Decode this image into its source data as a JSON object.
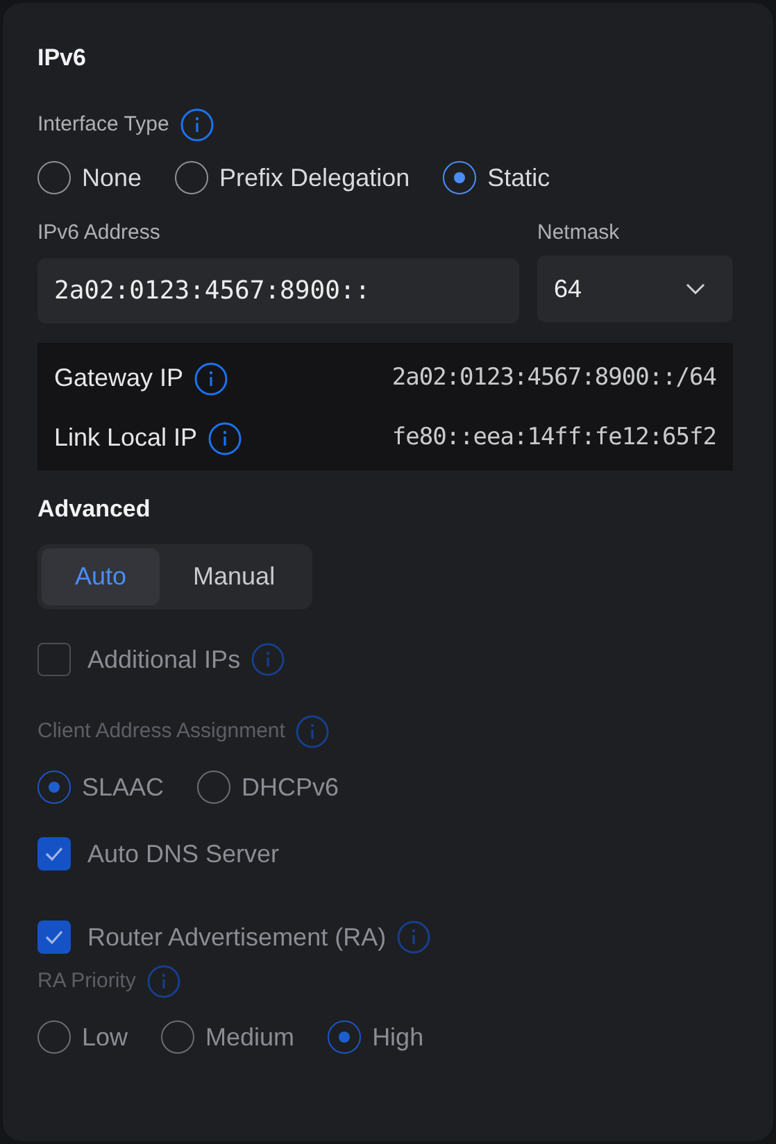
{
  "section_title": "IPv6",
  "interface_type": {
    "label": "Interface Type",
    "info": true,
    "options": [
      {
        "label": "None",
        "selected": false
      },
      {
        "label": "Prefix Delegation",
        "selected": false
      },
      {
        "label": "Static",
        "selected": true
      }
    ]
  },
  "ipv6_address": {
    "label": "IPv6 Address",
    "value": "2a02:0123:4567:8900::"
  },
  "netmask": {
    "label": "Netmask",
    "value": "64"
  },
  "info_rows": [
    {
      "label": "Gateway IP",
      "info": true,
      "value": "2a02:0123:4567:8900::/64"
    },
    {
      "label": "Link Local IP",
      "info": true,
      "value": "fe80::eea:14ff:fe12:65f2"
    }
  ],
  "advanced": {
    "title": "Advanced",
    "modes": [
      {
        "label": "Auto",
        "selected": true
      },
      {
        "label": "Manual",
        "selected": false
      }
    ],
    "items": [
      {
        "kind": "checkbox",
        "label": "Additional IPs",
        "checked": false,
        "disabled": true,
        "info": true
      },
      {
        "kind": "radio_group",
        "label": "Client Address Assignment",
        "disabled": true,
        "info": true,
        "options": [
          {
            "label": "SLAAC",
            "selected": true
          },
          {
            "label": "DHCPv6",
            "selected": false
          }
        ]
      },
      {
        "kind": "checkbox",
        "label": "Auto DNS Server",
        "checked": true,
        "disabled": true,
        "info": false
      },
      {
        "kind": "checkbox",
        "label": "Router Advertisement (RA)",
        "checked": true,
        "disabled": true,
        "info": true
      },
      {
        "kind": "radio_group",
        "label": "RA Priority",
        "disabled": true,
        "info": true,
        "options": [
          {
            "label": "Low",
            "selected": false
          },
          {
            "label": "Medium",
            "selected": false
          },
          {
            "label": "High",
            "selected": true
          }
        ]
      }
    ]
  }
}
